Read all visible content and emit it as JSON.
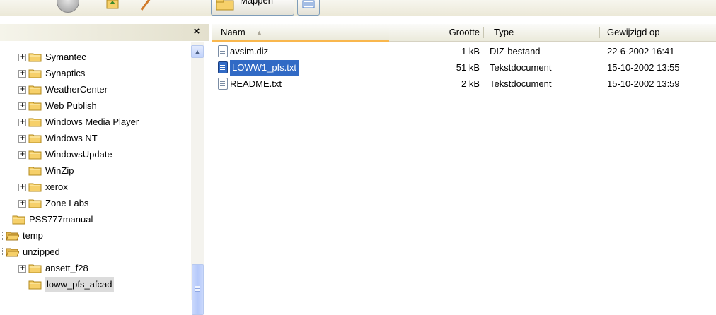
{
  "toolbar": {
    "folders_label": "Mappen"
  },
  "left_pane": {
    "close_label": "×",
    "tree": [
      {
        "label": "Symantec",
        "expander": "+"
      },
      {
        "label": "Synaptics",
        "expander": "+"
      },
      {
        "label": "WeatherCenter",
        "expander": "+"
      },
      {
        "label": "Web Publish",
        "expander": "+"
      },
      {
        "label": "Windows Media Player",
        "expander": "+"
      },
      {
        "label": "Windows NT",
        "expander": "+"
      },
      {
        "label": "WindowsUpdate",
        "expander": "+"
      },
      {
        "label": "WinZip",
        "expander": ""
      },
      {
        "label": "xerox",
        "expander": "+"
      },
      {
        "label": "Zone Labs",
        "expander": "+"
      },
      {
        "label": "PSS777manual",
        "expander": ""
      },
      {
        "label": "temp",
        "expander": ""
      },
      {
        "label": "unzipped",
        "expander": ""
      },
      {
        "label": "ansett_f28",
        "expander": "+"
      },
      {
        "label": "loww_pfs_afcad",
        "expander": "",
        "selected": true
      }
    ]
  },
  "file_list": {
    "columns": {
      "name": "Naam",
      "size": "Grootte",
      "type": "Type",
      "modified": "Gewijzigd op"
    },
    "rows": [
      {
        "name": "avsim.diz",
        "size": "1 kB",
        "type": "DIZ-bestand",
        "modified": "22-6-2002 16:41",
        "selected": false
      },
      {
        "name": "LOWW1_pfs.txt",
        "size": "51 kB",
        "type": "Tekstdocument",
        "modified": "15-10-2002 13:55",
        "selected": true
      },
      {
        "name": "README.txt",
        "size": "2 kB",
        "type": "Tekstdocument",
        "modified": "15-10-2002 13:59",
        "selected": false
      }
    ]
  },
  "colors": {
    "selection": "#316ac5",
    "folder": "#f6d06a",
    "sort_header_accent": "#f9b74d"
  }
}
